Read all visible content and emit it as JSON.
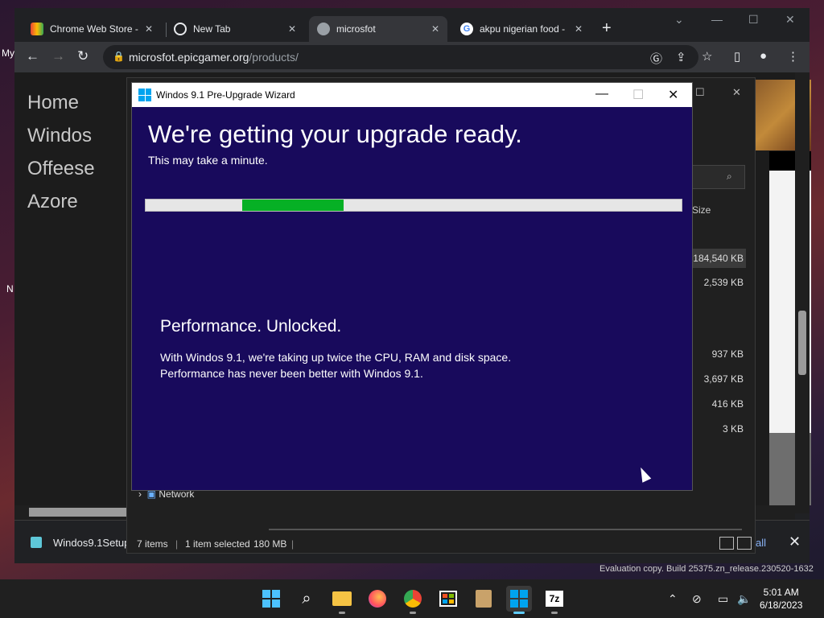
{
  "desktop": {
    "fragments": [
      "My",
      "N"
    ]
  },
  "browser": {
    "tabs": [
      {
        "label": "Chrome Web Store -",
        "active": false
      },
      {
        "label": "New Tab",
        "active": false
      },
      {
        "label": "microsfot",
        "active": true
      },
      {
        "label": "akpu nigerian food -",
        "active": false
      }
    ],
    "new_tab_label": "+",
    "url_host": "microsfot.epicgamer.org",
    "url_path": "/products/",
    "download": {
      "filename": "Windos9.1Setup",
      "show_all_label": "all"
    }
  },
  "page": {
    "nav": [
      "Home",
      "Windos",
      "Offeese",
      "Azore"
    ]
  },
  "explorer": {
    "size_header": "Size",
    "sizes": [
      "184,540 KB",
      "2,539 KB",
      "937 KB",
      "3,697 KB",
      "416 KB",
      "3 KB"
    ],
    "nav_network": "Network",
    "status": {
      "items": "7 items",
      "selected": "1 item selected",
      "size": "180 MB"
    }
  },
  "wizard": {
    "title": "Windos 9.1 Pre-Upgrade Wizard",
    "heading": "We're getting your upgrade ready.",
    "subheading": "This may take a minute.",
    "progress": {
      "start": 0.18,
      "end": 0.37
    },
    "feature_title": "Performance. Unlocked.",
    "feature_line1": "With Windos 9.1, we're taking up twice the CPU, RAM and disk space.",
    "feature_line2": "Performance has never been better with Windos 9.1."
  },
  "watermark": "Evaluation copy. Build 25375.zn_release.230520-1632",
  "taskbar": {
    "items": [
      "start-icon",
      "search-icon",
      "file-explorer-icon",
      "firefox-icon",
      "chrome-icon",
      "store-icon",
      "package-icon",
      "wizard-icon",
      "7zip-icon"
    ],
    "time": "5:01 AM",
    "date": "6/18/2023",
    "sevenzip_label": "7z"
  },
  "colors": {
    "wizard_bg": "#180a5c",
    "progress_fill": "#06b025",
    "chrome_dark": "#202124"
  }
}
